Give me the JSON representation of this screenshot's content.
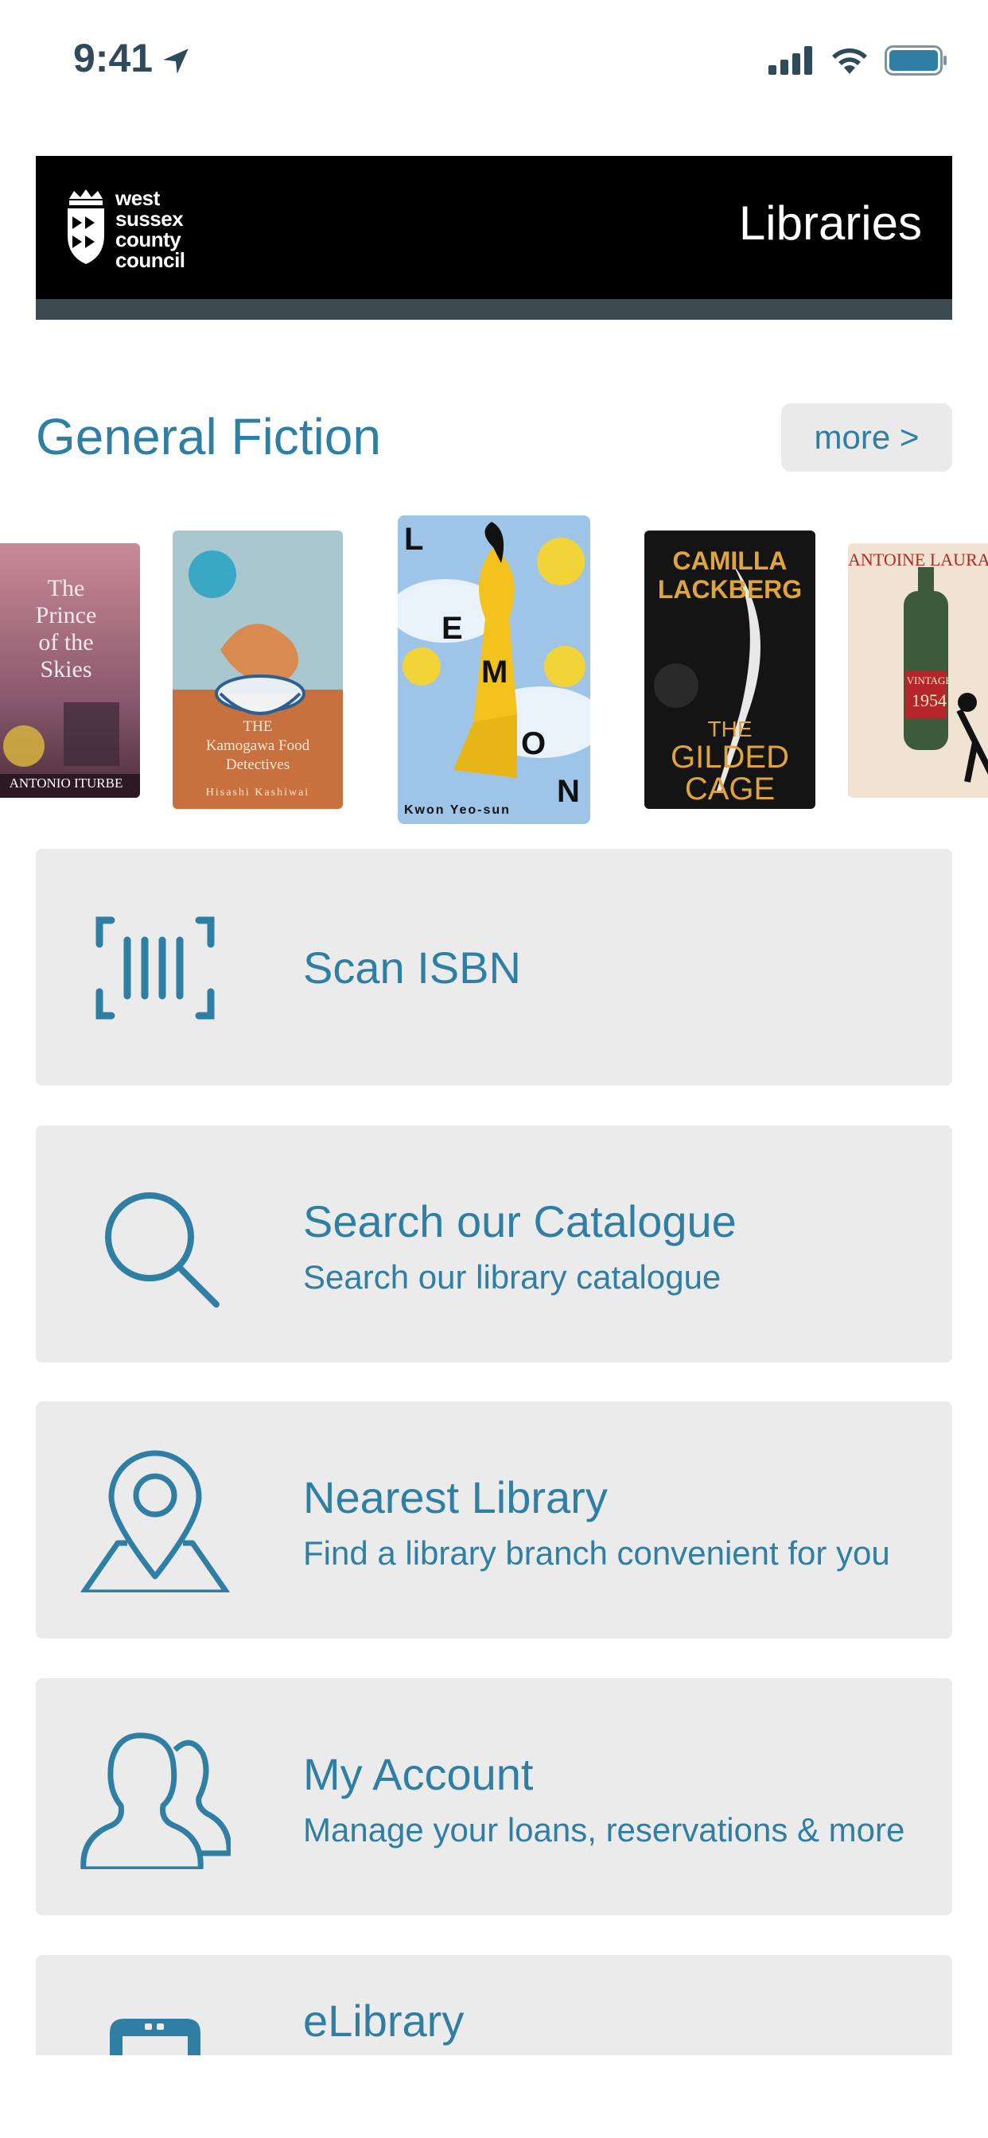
{
  "status_bar": {
    "time": "9:41"
  },
  "header": {
    "logo_lines": [
      "west",
      "sussex",
      "county",
      "council"
    ],
    "title": "Libraries"
  },
  "section": {
    "title": "General Fiction",
    "more_label": "more >"
  },
  "books": [
    {
      "title_lines": [
        "The",
        "Prince",
        "of the",
        "Skies"
      ],
      "author": "ANTONIO ITURBE"
    },
    {
      "title_lines": [
        "THE",
        "Kamogawa Food",
        "Detectives"
      ],
      "author": "Hisashi Kashiwai"
    },
    {
      "title_letters": [
        "L",
        "E",
        "M",
        "O",
        "N"
      ],
      "author": "Kwon Yeo-sun"
    },
    {
      "title_lines": [
        "CAMILLA",
        "LACKBERG",
        "THE",
        "GILDED",
        "CAGE"
      ],
      "author": ""
    },
    {
      "title_lines": [
        "ANTOINE LAURAIN",
        "VINTAGE",
        "1954"
      ],
      "author": ""
    }
  ],
  "menu": [
    {
      "title": "Scan ISBN",
      "subtitle": "",
      "icon": "barcode-scan-icon"
    },
    {
      "title": "Search our Catalogue",
      "subtitle": "Search our library catalogue",
      "icon": "search-icon"
    },
    {
      "title": "Nearest Library",
      "subtitle": "Find a library branch convenient for you",
      "icon": "map-pin-icon"
    },
    {
      "title": "My Account",
      "subtitle": "Manage your loans, reservations & more",
      "icon": "users-icon"
    },
    {
      "title": "eLibrary",
      "subtitle": "",
      "icon": "tablet-icon"
    }
  ],
  "colors": {
    "accent": "#2e7fa3",
    "card_bg": "#ebebeb",
    "banner_bg": "#000000",
    "banner_strip": "#3d4a52"
  }
}
